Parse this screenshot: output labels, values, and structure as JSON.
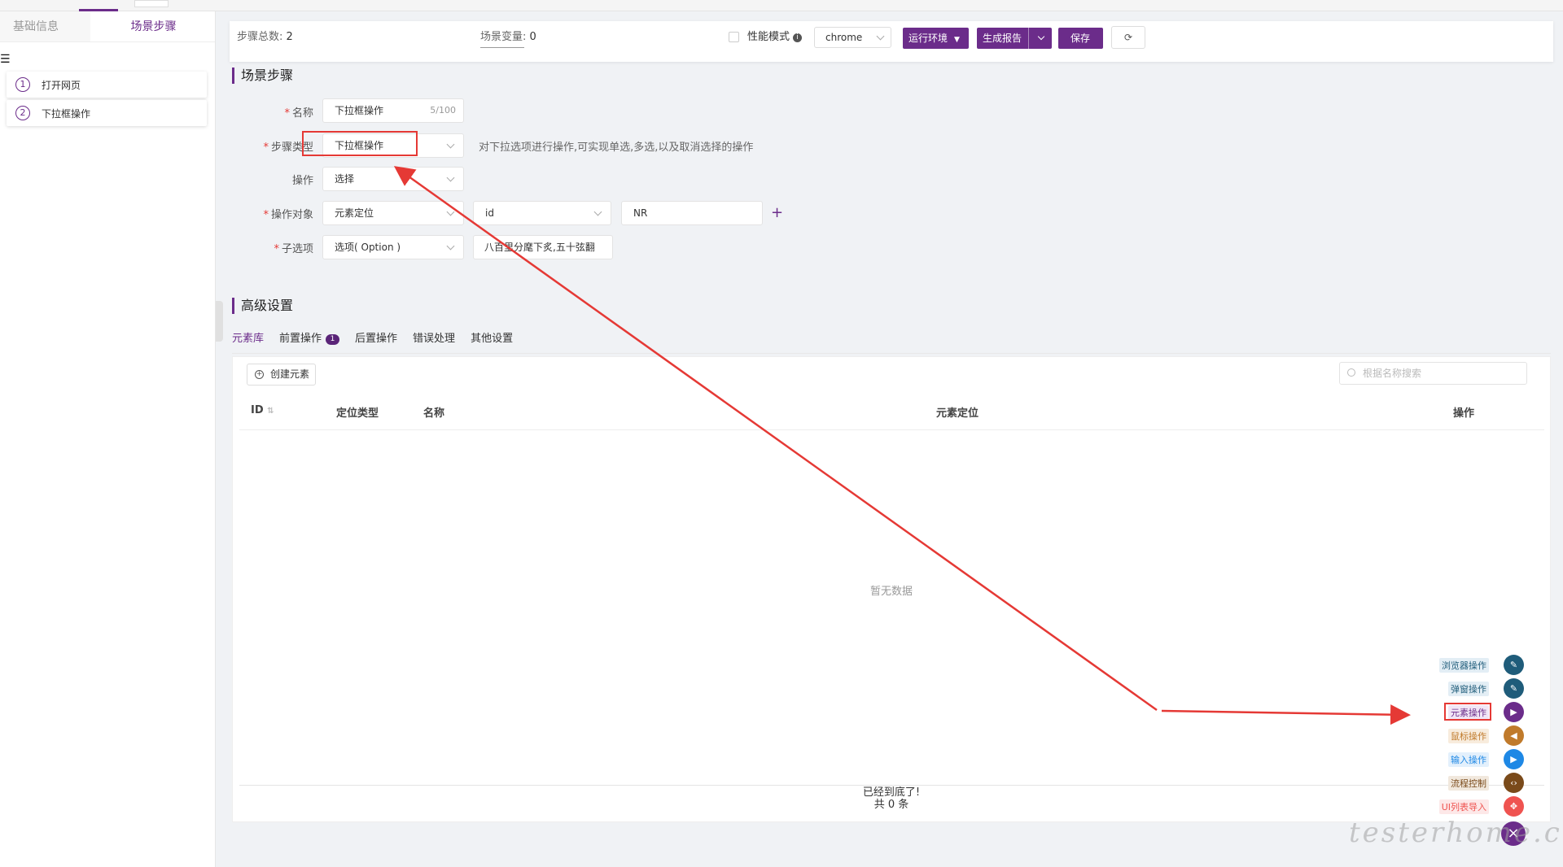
{
  "left_panel": {
    "tabs": [
      {
        "label": "基础信息",
        "active": false
      },
      {
        "label": "场景步骤",
        "active": true
      }
    ],
    "menu_icon": "hamburger-icon",
    "steps": [
      {
        "num": "1",
        "label": "打开网页"
      },
      {
        "num": "2",
        "label": "下拉框操作"
      }
    ]
  },
  "toolbar": {
    "steps_total_label": "步骤总数:",
    "steps_total_value": "2",
    "scene_var_label": "场景变量:",
    "scene_var_value": "0",
    "perf_mode_label": "性能模式",
    "browser_value": "chrome",
    "run_env_label": "运行环境",
    "gen_report_label": "生成报告",
    "save_label": "保存",
    "refresh_icon": "refresh-icon"
  },
  "scene_section": {
    "title": "场景步骤",
    "name_label": "名称",
    "name_value": "下拉框操作",
    "name_count": "5/100",
    "step_type_label": "步骤类型",
    "step_type_value": "下拉框操作",
    "step_type_hint": "对下拉选项进行操作,可实现单选,多选,以及取消选择的操作",
    "operation_label": "操作",
    "operation_value": "选择",
    "target_label": "操作对象",
    "target_locate_value": "元素定位",
    "target_by_value": "id",
    "target_text_value": "NR",
    "suboption_label": "子选项",
    "suboption_type_value": "选项( Option )",
    "suboption_text_value": "八百里分麾下炙,五十弦翻"
  },
  "advanced": {
    "title": "高级设置",
    "tabs": [
      {
        "label": "元素库",
        "badge": ""
      },
      {
        "label": "前置操作",
        "badge": "1"
      },
      {
        "label": "后置操作",
        "badge": ""
      },
      {
        "label": "错误处理",
        "badge": ""
      },
      {
        "label": "其他设置",
        "badge": ""
      }
    ],
    "create_label": "创建元素",
    "search_placeholder": "根据名称搜索",
    "columns": [
      "ID",
      "定位类型",
      "名称",
      "元素定位",
      "操作"
    ],
    "empty_text": "暂无数据",
    "footer_end": "已经到底了!",
    "footer_count": "共 0 条"
  },
  "fab_menu": [
    {
      "label": "浏览器操作",
      "color": "#1f5c7a",
      "bg": "#e3eef5",
      "icon": "pencil-icon",
      "glyph": "✎"
    },
    {
      "label": "弹窗操作",
      "color": "#1f5c7a",
      "bg": "#e3eef5",
      "icon": "pencil-icon",
      "glyph": "✎"
    },
    {
      "label": "元素操作",
      "color": "#6b2c8a",
      "bg": "#f1e6f6",
      "icon": "play-skip-icon",
      "glyph": "▶"
    },
    {
      "label": "鼠标操作",
      "color": "#c07a2b",
      "bg": "#f8ecdd",
      "icon": "skip-back-icon",
      "glyph": "◀"
    },
    {
      "label": "输入操作",
      "color": "#1e88e5",
      "bg": "#e3f0fc",
      "icon": "skip-forward-icon",
      "glyph": "▶"
    },
    {
      "label": "流程控制",
      "color": "#7a4a1a",
      "bg": "#f1e8dd",
      "icon": "code-icon",
      "glyph": "‹›"
    },
    {
      "label": "UI列表导入",
      "color": "#ef5350",
      "bg": "#fde8e8",
      "icon": "crosshair-icon",
      "glyph": "✥"
    }
  ],
  "watermark": "testerhome.com"
}
